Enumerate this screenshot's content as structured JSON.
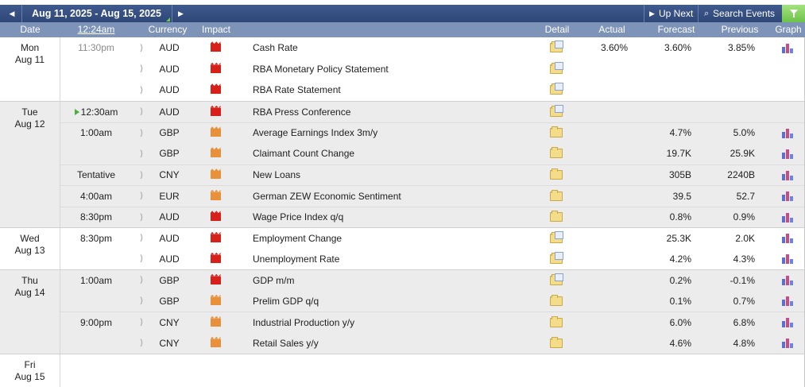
{
  "toolbar": {
    "prev_icon": "◀",
    "next_icon": "▶",
    "date_range": "Aug 11, 2025 - Aug 15, 2025",
    "up_next_icon": "▶",
    "up_next_label": "Up Next",
    "search_icon": "🔍",
    "search_label": "Search Events",
    "filter_icon": "filter-icon"
  },
  "columns": {
    "date": "Date",
    "time": "12:24am",
    "currency": "Currency",
    "impact": "Impact",
    "detail": "Detail",
    "actual": "Actual",
    "forecast": "Forecast",
    "previous": "Previous",
    "graph": "Graph"
  },
  "colors": {
    "high_impact": "#d8201a",
    "medium_impact": "#e8903a",
    "header": "#7e93b8",
    "toolbar": "#34497a",
    "filter": "#6cc24a"
  },
  "days": [
    {
      "weekday": "Mon",
      "date": "Aug 11"
    },
    {
      "weekday": "Tue",
      "date": "Aug 12"
    },
    {
      "weekday": "Wed",
      "date": "Aug 13"
    },
    {
      "weekday": "Thu",
      "date": "Aug 14"
    },
    {
      "weekday": "Fri",
      "date": "Aug 15"
    }
  ],
  "events": [
    {
      "time": "11:30pm",
      "currency": "AUD",
      "impact": "high",
      "name": "Cash Rate",
      "actual": "3.60%",
      "forecast": "3.60%",
      "previous": "3.85%",
      "detail": "open",
      "graph": true
    },
    {
      "time": "",
      "currency": "AUD",
      "impact": "high",
      "name": "RBA Monetary Policy Statement",
      "actual": "",
      "forecast": "",
      "previous": "",
      "detail": "open",
      "graph": false
    },
    {
      "time": "",
      "currency": "AUD",
      "impact": "high",
      "name": "RBA Rate Statement",
      "actual": "",
      "forecast": "",
      "previous": "",
      "detail": "open",
      "graph": false
    },
    {
      "time": "12:30am",
      "currency": "AUD",
      "impact": "high",
      "name": "RBA Press Conference",
      "actual": "",
      "forecast": "",
      "previous": "",
      "detail": "open",
      "graph": false
    },
    {
      "time": "1:00am",
      "currency": "GBP",
      "impact": "medium",
      "name": "Average Earnings Index 3m/y",
      "actual": "",
      "forecast": "4.7%",
      "previous": "5.0%",
      "detail": "closed",
      "graph": true
    },
    {
      "time": "",
      "currency": "GBP",
      "impact": "medium",
      "name": "Claimant Count Change",
      "actual": "",
      "forecast": "19.7K",
      "previous": "25.9K",
      "detail": "closed",
      "graph": true
    },
    {
      "time": "Tentative",
      "currency": "CNY",
      "impact": "medium",
      "name": "New Loans",
      "actual": "",
      "forecast": "305B",
      "previous": "2240B",
      "detail": "closed",
      "graph": true
    },
    {
      "time": "4:00am",
      "currency": "EUR",
      "impact": "medium",
      "name": "German ZEW Economic Sentiment",
      "actual": "",
      "forecast": "39.5",
      "previous": "52.7",
      "detail": "closed",
      "graph": true
    },
    {
      "time": "8:30pm",
      "currency": "AUD",
      "impact": "high",
      "name": "Wage Price Index q/q",
      "actual": "",
      "forecast": "0.8%",
      "previous": "0.9%",
      "detail": "closed",
      "graph": true
    },
    {
      "time": "8:30pm",
      "currency": "AUD",
      "impact": "high",
      "name": "Employment Change",
      "actual": "",
      "forecast": "25.3K",
      "previous": "2.0K",
      "detail": "open",
      "graph": true
    },
    {
      "time": "",
      "currency": "AUD",
      "impact": "high",
      "name": "Unemployment Rate",
      "actual": "",
      "forecast": "4.2%",
      "previous": "4.3%",
      "detail": "open",
      "graph": true
    },
    {
      "time": "1:00am",
      "currency": "GBP",
      "impact": "high",
      "name": "GDP m/m",
      "actual": "",
      "forecast": "0.2%",
      "previous": "-0.1%",
      "detail": "open",
      "graph": true
    },
    {
      "time": "",
      "currency": "GBP",
      "impact": "medium",
      "name": "Prelim GDP q/q",
      "actual": "",
      "forecast": "0.1%",
      "previous": "0.7%",
      "detail": "closed",
      "graph": true
    },
    {
      "time": "9:00pm",
      "currency": "CNY",
      "impact": "medium",
      "name": "Industrial Production y/y",
      "actual": "",
      "forecast": "6.0%",
      "previous": "6.8%",
      "detail": "closed",
      "graph": true
    },
    {
      "time": "",
      "currency": "CNY",
      "impact": "medium",
      "name": "Retail Sales y/y",
      "actual": "",
      "forecast": "4.6%",
      "previous": "4.8%",
      "detail": "closed",
      "graph": true
    }
  ]
}
